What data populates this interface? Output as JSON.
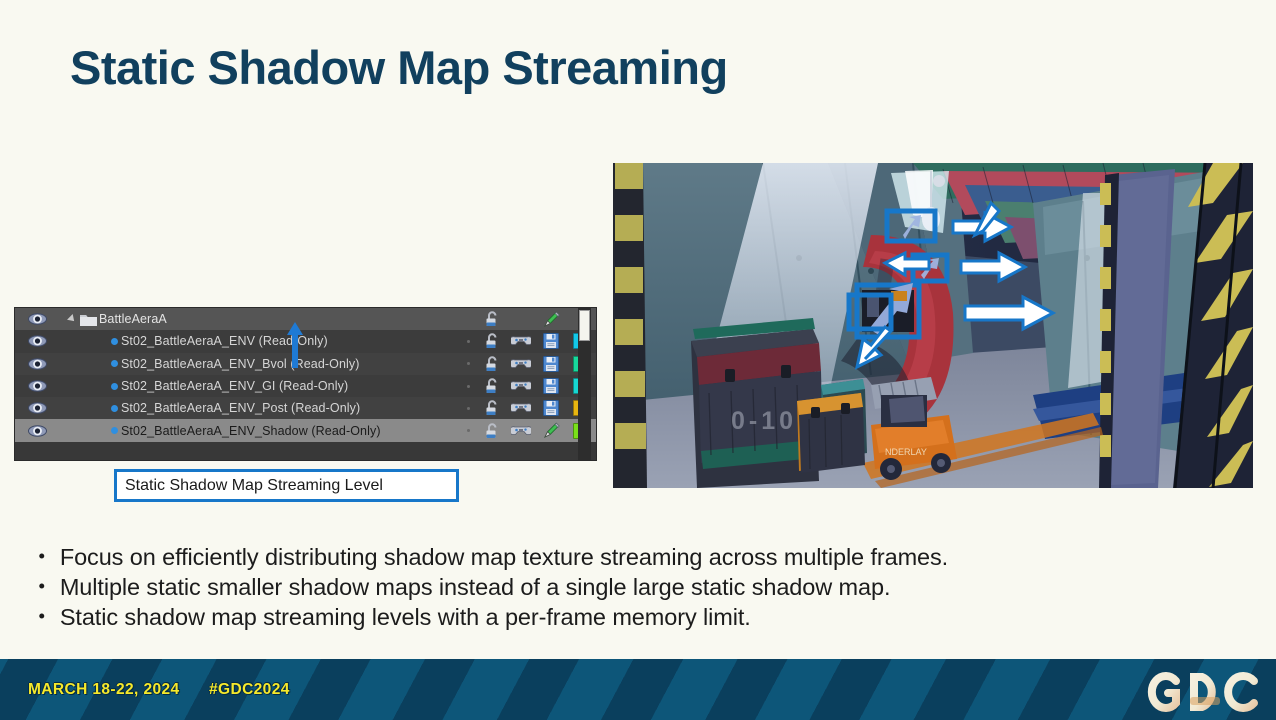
{
  "slide": {
    "title": "Static Shadow Map Streaming",
    "background_color": "#f9f9f1",
    "title_color": "#11405e"
  },
  "hierarchy_panel": {
    "panel_background": "#383838",
    "selected_row_color": "#8a8a8a",
    "scrollbar_thumb_color": "#f4f4ee",
    "columns": [
      "visibility",
      "name",
      "mini",
      "lock",
      "gamepad",
      "save",
      "color"
    ],
    "rows": [
      {
        "name": "BattleAeraA",
        "indent": 0,
        "icon": "folder-icon",
        "expander": "triangle-expanded",
        "eye": true,
        "mini_dot": false,
        "lock": true,
        "gamepad": false,
        "action_icon": "pencil-icon",
        "swatch_color": "",
        "selected": false,
        "header": true
      },
      {
        "name": "St02_BattleAeraA_ENV (Read-Only)",
        "indent": 1,
        "icon": "dot-icon",
        "expander": "",
        "eye": true,
        "mini_dot": true,
        "lock": true,
        "gamepad": true,
        "action_icon": "save-icon",
        "swatch_color": "#13c8e8",
        "selected": false,
        "header": false
      },
      {
        "name": "St02_BattleAeraA_ENV_Bvol (Read-Only)",
        "indent": 1,
        "icon": "dot-icon",
        "expander": "",
        "eye": true,
        "mini_dot": true,
        "lock": true,
        "gamepad": true,
        "action_icon": "save-icon",
        "swatch_color": "#18d89c",
        "selected": false,
        "header": false
      },
      {
        "name": "St02_BattleAeraA_ENV_GI (Read-Only)",
        "indent": 1,
        "icon": "dot-icon",
        "expander": "",
        "eye": true,
        "mini_dot": true,
        "lock": true,
        "gamepad": true,
        "action_icon": "save-icon",
        "swatch_color": "#17d7d2",
        "selected": false,
        "header": false
      },
      {
        "name": "St02_BattleAeraA_ENV_Post (Read-Only)",
        "indent": 1,
        "icon": "dot-icon",
        "expander": "",
        "eye": true,
        "mini_dot": true,
        "lock": true,
        "gamepad": true,
        "action_icon": "save-icon",
        "swatch_color": "#e8b611",
        "selected": false,
        "header": false
      },
      {
        "name": "St02_BattleAeraA_ENV_Shadow (Read-Only)",
        "indent": 1,
        "icon": "dot-icon",
        "expander": "",
        "eye": true,
        "mini_dot": true,
        "lock": true,
        "gamepad": true,
        "action_icon": "pencil-icon",
        "swatch_color": "#7ae01a",
        "selected": true,
        "header": false
      }
    ],
    "overlay_arrow": "blue-up-arrow"
  },
  "callout": {
    "label": "Static Shadow Map Streaming Level",
    "border_color": "#1777c9",
    "fill_color": "#ffffff"
  },
  "game_screenshot": {
    "description": "In-game sci-fi hangar corridor with cel-shaded art style",
    "crate_label": "0-10",
    "vehicle_label": "NDERLAY",
    "annotation_box_color": "#1777c9",
    "arrow_color": "#ffffff",
    "highlighted_regions": 4,
    "arrows": 5
  },
  "bullets": [
    "・ Focus on efficiently distributing shadow map texture streaming across multiple frames.",
    "・ Multiple static smaller shadow maps instead of a single large static shadow map.",
    "・ Static shadow map streaming levels with a per-frame memory limit."
  ],
  "footer": {
    "date": "MARCH 18-22, 2024",
    "hashtag": "#GDC2024",
    "logo_text": "GDC",
    "text_color": "#f6e92b",
    "stripe_dark": "#0a3f5d",
    "stripe_light": "#0d5679"
  }
}
